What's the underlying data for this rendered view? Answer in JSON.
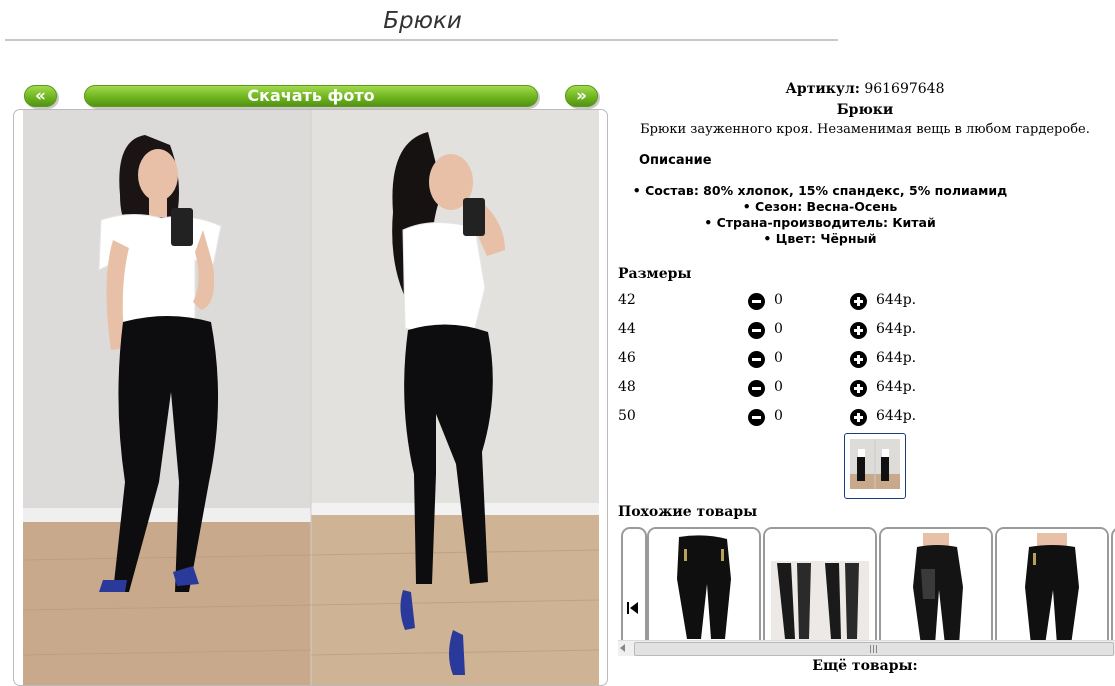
{
  "page": {
    "title": "Брюки"
  },
  "photo_nav": {
    "prev_label": "«",
    "download_label": "Скачать фото",
    "next_label": "»"
  },
  "product": {
    "sku_label": "Артикул:",
    "sku_value": "961697648",
    "name": "Брюки",
    "description": "Брюки зауженного кроя. Незаменимая вещь в любом гардеробе.",
    "specs_title": "Описание",
    "specs": [
      "• Состав: 80% хлопок, 15% спандекс, 5% полиамид",
      "• Сезон: Весна-Осень",
      "• Страна-производитель: Китай",
      "• Цвет: Чёрный"
    ]
  },
  "sizes": {
    "title": "Размеры",
    "rows": [
      {
        "size": "42",
        "qty": "0",
        "price": "644р."
      },
      {
        "size": "44",
        "qty": "0",
        "price": "644р."
      },
      {
        "size": "46",
        "qty": "0",
        "price": "644р."
      },
      {
        "size": "48",
        "qty": "0",
        "price": "644р."
      },
      {
        "size": "50",
        "qty": "0",
        "price": "644р."
      }
    ]
  },
  "similar": {
    "title": "Похожие товары",
    "more_label": "Ещё товары:"
  },
  "colors": {
    "accent_green": "#6fb51f",
    "thumb_border": "#1c3d7a"
  }
}
